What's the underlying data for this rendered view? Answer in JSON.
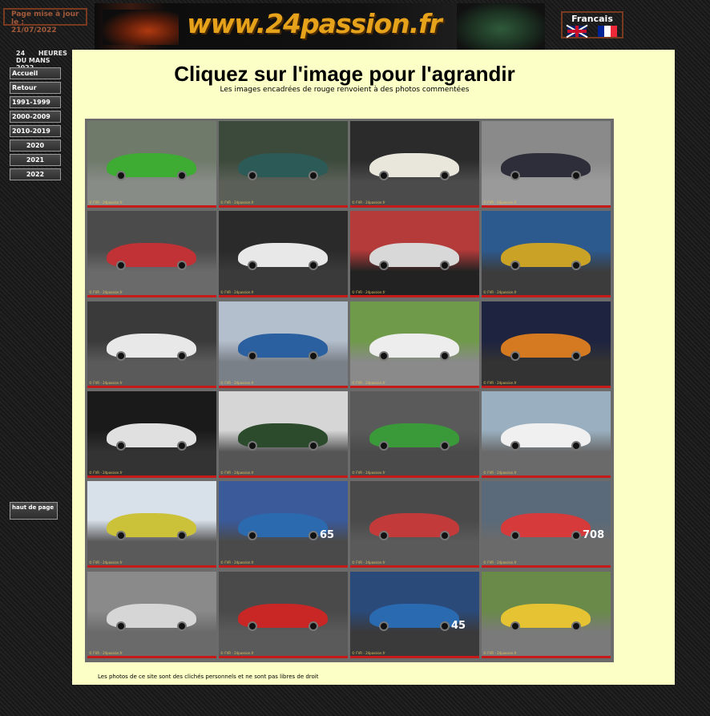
{
  "update_box": {
    "line1": "Page mise à jour le :",
    "line2": "21/07/2022"
  },
  "banner": {
    "site": "www.24passion.fr"
  },
  "language": {
    "label": "Francais",
    "options": [
      "English",
      "Français"
    ]
  },
  "sidebar": {
    "event_line1": "24      HEURES",
    "event_line2": "DU MANS 2022",
    "nav": [
      {
        "label": "Accueil",
        "align": "left"
      },
      {
        "label": "Retour",
        "align": "left"
      },
      {
        "label": "1991-1999",
        "align": "left"
      },
      {
        "label": "2000-2009",
        "align": "left"
      },
      {
        "label": "2010-2019",
        "align": "left"
      },
      {
        "label": "2020",
        "align": "center"
      },
      {
        "label": "2021",
        "align": "center"
      },
      {
        "label": "2022",
        "align": "center"
      }
    ],
    "top_link": "haut de page"
  },
  "main": {
    "title": "Cliquez sur l'image pour l'agrandir",
    "subtitle": "Les images encadrées de rouge renvoient à des photos commentées"
  },
  "photos": [
    {
      "bg": "#6f7a6a",
      "track": "#878c86",
      "car": "#3eab33",
      "num": ""
    },
    {
      "bg": "#3b4a3b",
      "track": "#5a5f57",
      "car": "#2c5a56",
      "num": ""
    },
    {
      "bg": "#2b2b2b",
      "track": "#4b4b4b",
      "car": "#e9e6dc",
      "num": ""
    },
    {
      "bg": "#8a8a8a",
      "track": "#9a9a9a",
      "car": "#2e2e3a",
      "num": ""
    },
    {
      "bg": "#4b4b4b",
      "track": "#6a6a6a",
      "car": "#c13236",
      "num": ""
    },
    {
      "bg": "#2a2a2a",
      "track": "#3a3a3a",
      "car": "#e8e8e8",
      "num": ""
    },
    {
      "bg": "#b53a3a",
      "track": "#222222",
      "car": "#d8d8d8",
      "num": ""
    },
    {
      "bg": "#2d5a8e",
      "track": "#3c3c3c",
      "car": "#c9a226",
      "num": ""
    },
    {
      "bg": "#3a3a3a",
      "track": "#5a5a5a",
      "car": "#e8e8e8",
      "num": ""
    },
    {
      "bg": "#b4bfcd",
      "track": "#7a8088",
      "car": "#2a5fa0",
      "num": ""
    },
    {
      "bg": "#6f9a4a",
      "track": "#8a8a8a",
      "car": "#ededed",
      "num": ""
    },
    {
      "bg": "#1e2340",
      "track": "#333333",
      "car": "#d67a22",
      "num": ""
    },
    {
      "bg": "#1a1a1a",
      "track": "#333333",
      "car": "#e0e0e0",
      "num": ""
    },
    {
      "bg": "#d6d6d6",
      "track": "#555555",
      "car": "#2c4a2c",
      "num": ""
    },
    {
      "bg": "#5a5a5a",
      "track": "#4a4a4a",
      "car": "#3a9a3a",
      "num": ""
    },
    {
      "bg": "#9ab0c0",
      "track": "#6a6a6a",
      "car": "#f0f0f0",
      "num": ""
    },
    {
      "bg": "#d8e0ea",
      "track": "#5a5a5a",
      "car": "#cbc23a",
      "num": ""
    },
    {
      "bg": "#3a5a9a",
      "track": "#4a4a4a",
      "car": "#2c6ab0",
      "num": "65"
    },
    {
      "bg": "#4a4a4a",
      "track": "#5a5a5a",
      "car": "#c23a3a",
      "num": ""
    },
    {
      "bg": "#5a6a7a",
      "track": "#6a6a6a",
      "car": "#d63a3a",
      "num": "708"
    },
    {
      "bg": "#8a8a8a",
      "track": "#6a6a6a",
      "car": "#d6d6d6",
      "num": ""
    },
    {
      "bg": "#4a4a4a",
      "track": "#5a5a5a",
      "car": "#c92626",
      "num": ""
    },
    {
      "bg": "#2a4a7a",
      "track": "#3a3a3a",
      "car": "#2a6ab0",
      "num": "45"
    },
    {
      "bg": "#6a8a4a",
      "track": "#7a7a7a",
      "car": "#e5c332",
      "num": ""
    }
  ],
  "watermark": "© FVR - 24passion.fr",
  "footer": "Les photos de ce site sont des clichés personnels et ne sont pas libres de droit"
}
